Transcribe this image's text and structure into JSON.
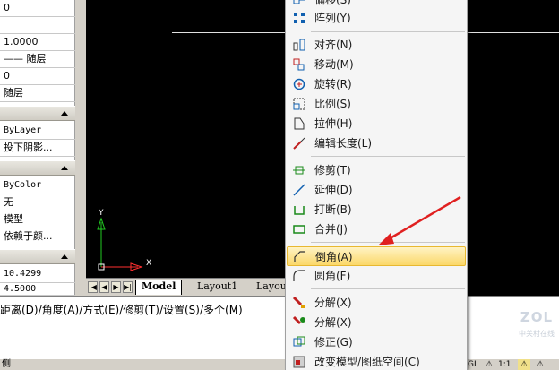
{
  "properties": {
    "row_top_value": "0",
    "row_1": "1.0000",
    "row_2": "—— 随层",
    "row_3": "0",
    "row_4": "随层",
    "row_5": "ByLayer",
    "row_6": "投下阴影...",
    "row_7": "ByColor",
    "row_8": "无",
    "row_9": "模型",
    "row_10": "依赖于颜...",
    "row_11": "10.4299",
    "row_12": "4.5000"
  },
  "ucs": {
    "y_label": "Y",
    "x_label": "X"
  },
  "layout_tabs": {
    "model": "Model",
    "layout1": "Layout1",
    "layout2": "Layout"
  },
  "command_line": {
    "text": "距离(D)/角度(A)/方式(E)/修剪(T)/设置(S)/多个(M)",
    "bottom_char": "侧"
  },
  "status_bar": {
    "scale": "1:1",
    "gl": "GL"
  },
  "context_menu": {
    "items": [
      {
        "label": "偏移(S)"
      },
      {
        "label": "阵列(Y)"
      },
      {
        "label": "对齐(N)"
      },
      {
        "label": "移动(M)"
      },
      {
        "label": "旋转(R)"
      },
      {
        "label": "比例(S)"
      },
      {
        "label": "拉伸(H)"
      },
      {
        "label": "编辑长度(L)"
      },
      {
        "label": "修剪(T)"
      },
      {
        "label": "延伸(D)"
      },
      {
        "label": "打断(B)"
      },
      {
        "label": "合并(J)"
      },
      {
        "label": "倒角(A)"
      },
      {
        "label": "圆角(F)"
      },
      {
        "label": "分解(X)"
      },
      {
        "label": "分解(X)"
      },
      {
        "label": "修正(G)"
      },
      {
        "label": "改变模型/图纸空间(C)"
      }
    ]
  },
  "watermark": {
    "logo": "ZOL",
    "subtitle": "中关村在线"
  },
  "colors": {
    "arrow": "#e02020",
    "highlight": "#fbd86a",
    "ucs_green": "#22cc22",
    "ucs_red": "#ff3030"
  }
}
